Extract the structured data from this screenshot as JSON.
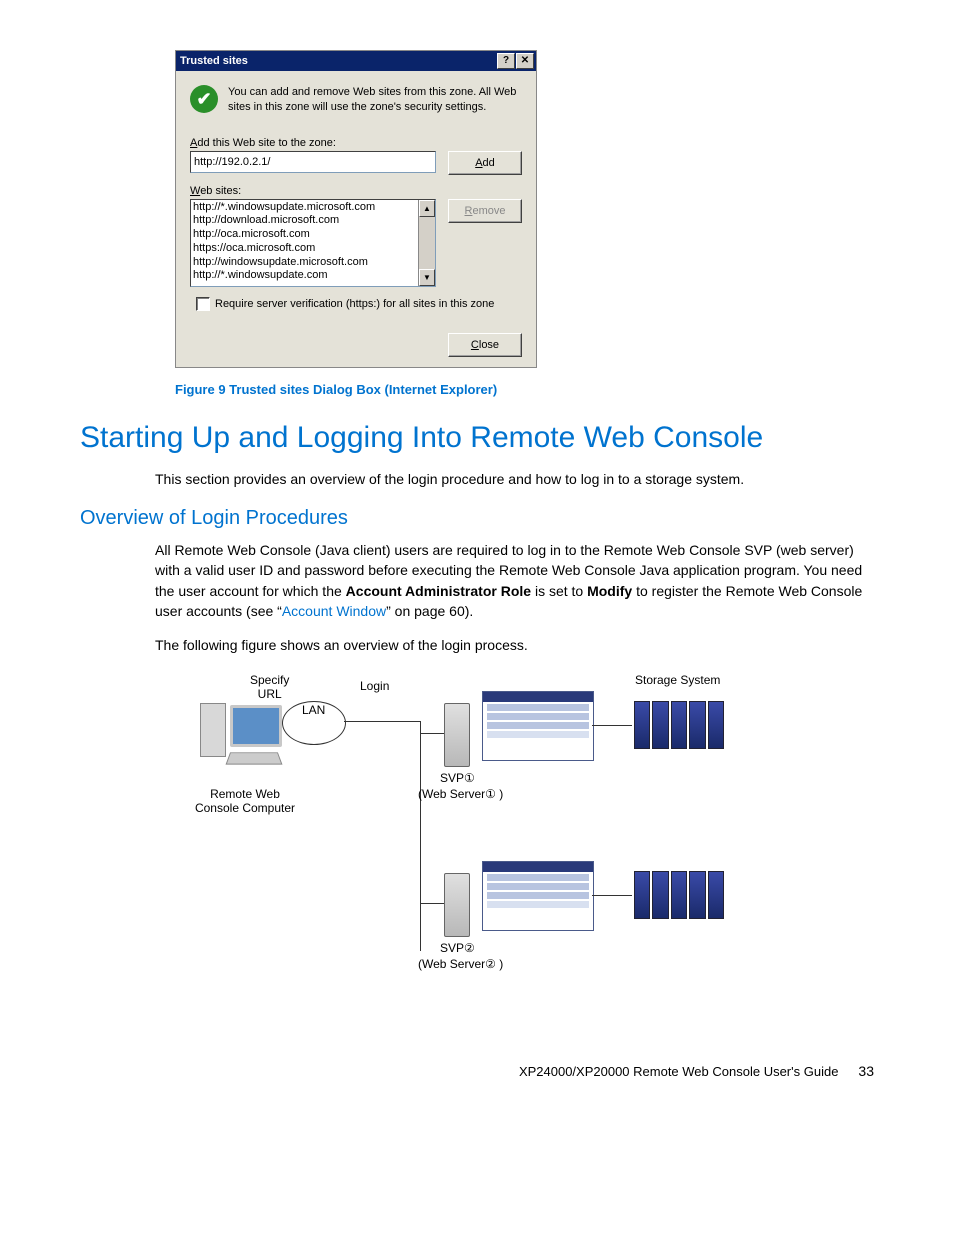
{
  "dialog": {
    "title": "Trusted sites",
    "info": "You can add and remove Web sites from this zone. All Web sites in this zone will use the zone's security settings.",
    "addLabel": "Add this Web site to the zone:",
    "addValue": "http://192.0.2.1/",
    "addBtn": "Add",
    "sitesLabel": "Web sites:",
    "sites": [
      "http://*.windowsupdate.microsoft.com",
      "http://download.microsoft.com",
      "http://oca.microsoft.com",
      "https://oca.microsoft.com",
      "http://windowsupdate.microsoft.com",
      "http://*.windowsupdate.com"
    ],
    "removeBtn": "Remove",
    "requireLabel": "Require server verification (https:) for all sites in this zone",
    "closeBtn": "Close"
  },
  "caption": "Figure 9 Trusted sites Dialog Box (Internet Explorer)",
  "h1": "Starting Up and Logging Into Remote Web Console",
  "intro": "This section provides an overview of the login procedure and how to log in to a storage system.",
  "h2": "Overview of Login Procedures",
  "para1a": "All Remote Web Console (Java client) users are required to log in to the Remote Web Console SVP (web server) with a valid user ID and password before executing the Remote Web Console Java application program. You need the user account for which the ",
  "para1b": "Account Administrator Role",
  "para1c": " is set to ",
  "para1d": "Modify",
  "para1e": " to register the Remote Web Console user accounts (see “",
  "para1link": "Account Window",
  "para1f": "” on page 60).",
  "para2": "The following figure shows an overview of the login process.",
  "diagram": {
    "specifyUrl": "Specify\nURL",
    "login": "Login",
    "lan": "LAN",
    "remoteWeb": "Remote Web\nConsole Computer",
    "svp1": "SVP①",
    "webServer1": "(Web Server① )",
    "svp2": "SVP②",
    "webServer2": "(Web Server② )",
    "storage": "Storage System"
  },
  "footer": {
    "title": "XP24000/XP20000 Remote Web Console User's Guide",
    "page": "33"
  }
}
